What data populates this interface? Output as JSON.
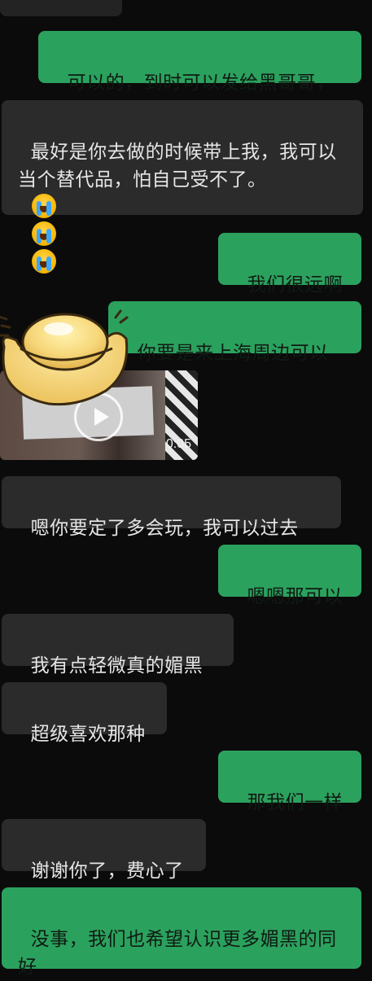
{
  "messages": [
    {
      "side": "out",
      "text": "可以的，到时可以发给黑哥哥，"
    },
    {
      "side": "in",
      "text": "最好是你去做的时候带上我，我可以当个替代品，怕自己受不了。"
    },
    {
      "side": "out",
      "text": "我们很远啊"
    },
    {
      "side": "out",
      "text": "你要是来上海周边可以"
    },
    {
      "side": "in_video",
      "duration": "0:05"
    },
    {
      "side": "in",
      "text": "嗯你要定了多会玩，我可以过去"
    },
    {
      "side": "out",
      "text": "嗯嗯那可以"
    },
    {
      "side": "in",
      "text": "我有点轻微真的媚黑"
    },
    {
      "side": "in",
      "text": "超级喜欢那种"
    },
    {
      "side": "out",
      "text": "那我们一样"
    },
    {
      "side": "in",
      "text": "谢谢你了，费心了"
    },
    {
      "side": "out",
      "text": "没事，我们也希望认识更多媚黑的同好"
    }
  ],
  "emoji_names": [
    "loudly-crying-face-icon",
    "loudly-crying-face-icon",
    "loudly-crying-face-icon"
  ],
  "colors": {
    "background": "#0b0b0b",
    "incoming_bubble": "#2b2b2b",
    "outgoing_bubble": "#2ba15e"
  }
}
